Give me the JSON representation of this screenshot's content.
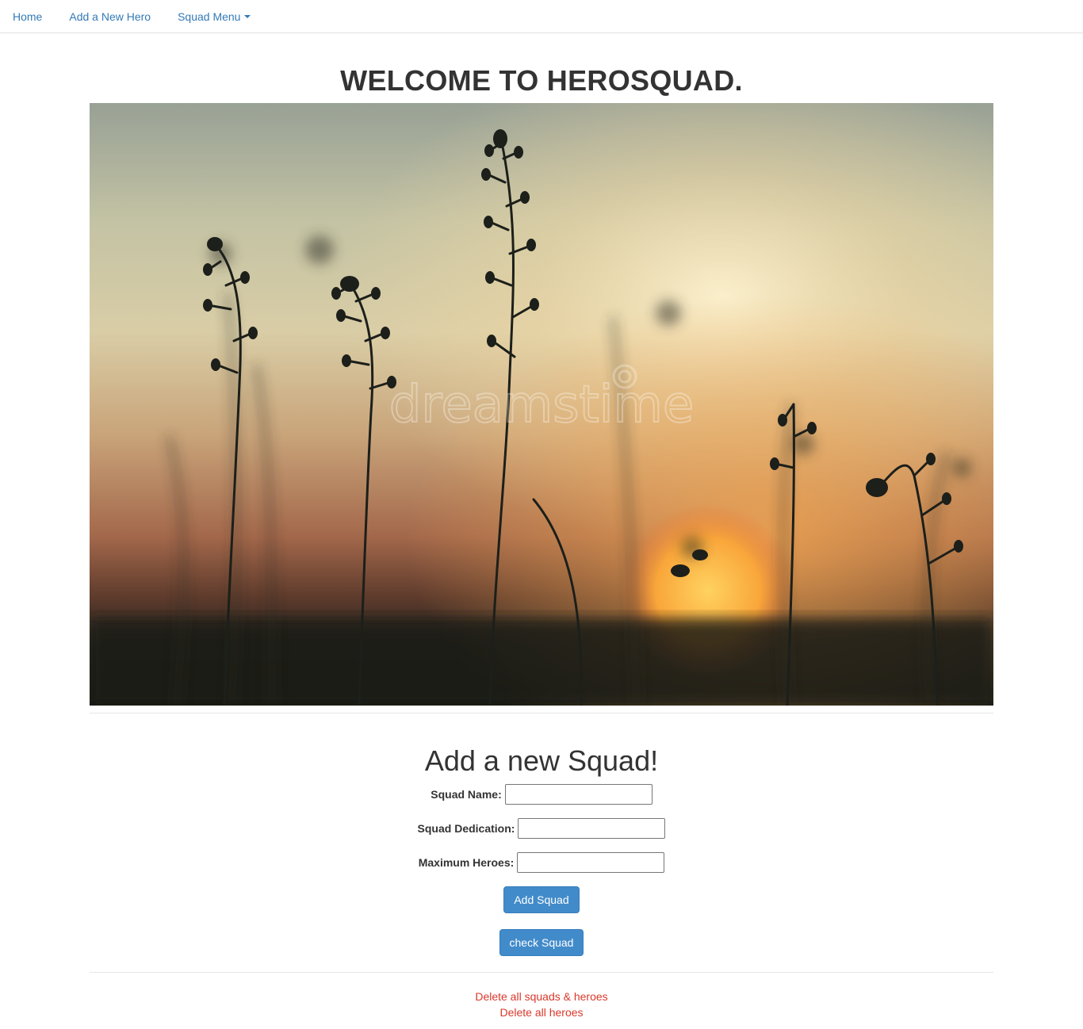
{
  "nav": {
    "home": "Home",
    "add_hero": "Add a New Hero",
    "squad_menu": "Squad Menu"
  },
  "page": {
    "title": "WELCOME TO HEROSQUAD.",
    "image_watermark": "dreamstime"
  },
  "form": {
    "title": "Add a new Squad!",
    "squad_name_label": "Squad Name:",
    "squad_name_value": "",
    "squad_dedication_label": "Squad Dedication:",
    "squad_dedication_value": "",
    "max_heroes_label": "Maximum Heroes:",
    "max_heroes_value": "",
    "add_button": "Add Squad",
    "check_button": "check Squad"
  },
  "actions": {
    "delete_all_squads": "Delete all squads & heroes",
    "delete_all_heroes": "Delete all heroes"
  },
  "colors": {
    "link": "#337ab7",
    "button": "#428bca",
    "danger": "#d9382b"
  }
}
